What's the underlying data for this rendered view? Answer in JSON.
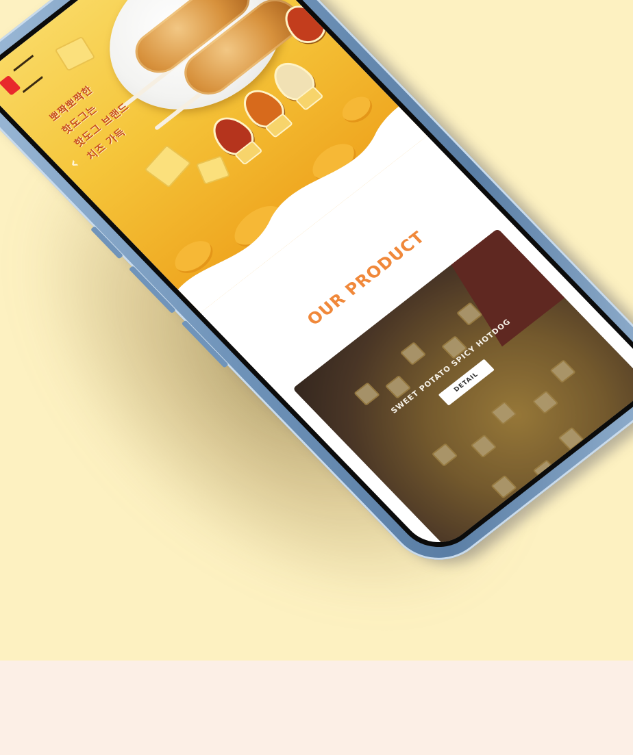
{
  "hero": {
    "korean_lines": [
      "뽀짝뽀짝한",
      "핫도그는",
      "핫도그 브랜드",
      "치즈 가득"
    ],
    "left_arrow_glyph": "‹",
    "icon": "chevron-left-icon"
  },
  "products": {
    "section_title": "OUR PRODUCT",
    "card_caption": "SWEET POTATO SPICY HOTDOG",
    "card_button_label": "DETAIL"
  },
  "colors": {
    "background": "#fdf1c1",
    "footer_band": "#fcefe6",
    "hero_yellow": "#f5c53a",
    "accent_orange": "#f0883a",
    "phone_frame": "#6f93b9"
  }
}
